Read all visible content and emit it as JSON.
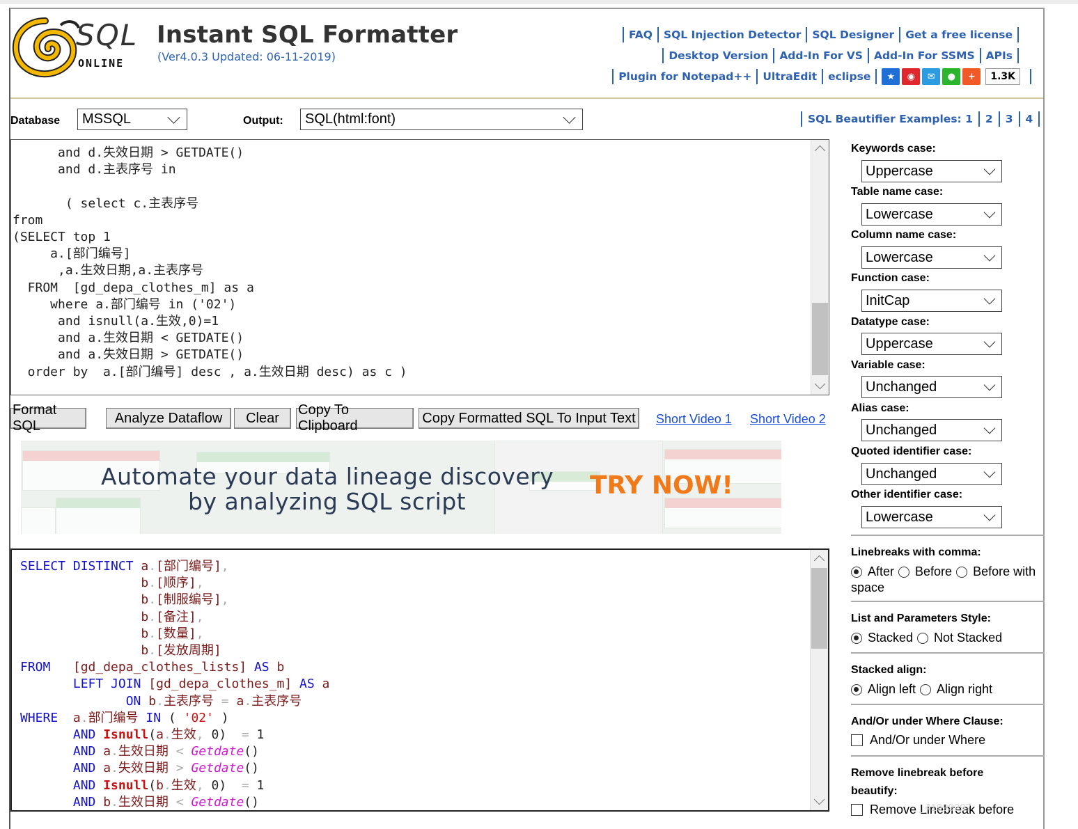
{
  "header": {
    "logo_sql": "SQL",
    "logo_online": "ONLINE",
    "title": "Instant SQL Formatter",
    "version": "(Ver4.0.3 Updated: 06-11-2019)",
    "nav_row1": [
      "FAQ",
      "SQL Injection Detector",
      "SQL Designer",
      "Get a free license"
    ],
    "nav_row2": [
      "Desktop Version",
      "Add-In For VS",
      "Add-In For SSMS",
      "APIs"
    ],
    "nav_row3": [
      "Plugin for Notepad++",
      "UltraEdit",
      "eclipse"
    ],
    "share_count": "1.3K"
  },
  "options_bar": {
    "database_label": "Database",
    "database_value": "MSSQL",
    "output_label": "Output:",
    "output_value": "SQL(html:font)",
    "examples_label": "SQL Beautifier Examples: 1",
    "examples": [
      "2",
      "3",
      "4"
    ]
  },
  "input_editor": {
    "lines": [
      "      and d.失效日期 > GETDATE()",
      "      and d.主表序号 in",
      "",
      "       ( select c.主表序号",
      "from",
      "(SELECT top 1",
      "     a.[部门编号]",
      "      ,a.生效日期,a.主表序号",
      "  FROM  [gd_depa_clothes_m] as a",
      "     where a.部门编号 in ('02')",
      "      and isnull(a.生效,0)=1",
      "      and a.生效日期 < GETDATE()",
      "      and a.失效日期 > GETDATE()",
      "  order by  a.[部门编号] desc , a.生效日期 desc) as c )"
    ]
  },
  "buttons": {
    "format": "Format SQL",
    "analyze": "Analyze Dataflow",
    "clear": "Clear",
    "copy": "Copy To Clipboard",
    "copy_formatted": "Copy Formatted SQL To Input Text",
    "video1": "Short Video 1",
    "video2": "Short Video 2"
  },
  "banner": {
    "line1": "Automate your data lineage discovery",
    "line2": "by analyzing SQL script",
    "cta": "TRY NOW!"
  },
  "settings": {
    "keywords_label": "Keywords case:",
    "keywords_value": "Uppercase",
    "table_label": "Table name case:",
    "table_value": "Lowercase",
    "column_label": "Column name case:",
    "column_value": "Lowercase",
    "function_label": "Function case:",
    "function_value": "InitCap",
    "datatype_label": "Datatype case:",
    "datatype_value": "Uppercase",
    "variable_label": "Variable case:",
    "variable_value": "Unchanged",
    "alias_label": "Alias case:",
    "alias_value": "Unchanged",
    "quoted_label": "Quoted identifier case:",
    "quoted_value": "Unchanged",
    "other_label": "Other identifier case:",
    "other_value": "Lowercase",
    "linebreaks_label": "Linebreaks with comma:",
    "lb_after": "After",
    "lb_before": "Before",
    "lb_before_space": "Before with",
    "lb_space_cont": "space",
    "list_label": "List and Parameters Style:",
    "list_stacked": "Stacked",
    "list_not_stacked": "Not Stacked",
    "align_label": "Stacked align:",
    "align_left": "Align left",
    "align_right": "Align right",
    "andor_label": "And/Or under Where Clause:",
    "andor_option": "And/Or under Where",
    "remove_label_1": "Remove linebreak before",
    "remove_label_2": "beautify:",
    "remove_option": "Remove Linebreak before"
  },
  "watermark": "_41999297",
  "colors": {
    "link": "#2e62b0",
    "keyword": "#1212c8",
    "function": "#c81212",
    "cta": "#f07a1a"
  }
}
